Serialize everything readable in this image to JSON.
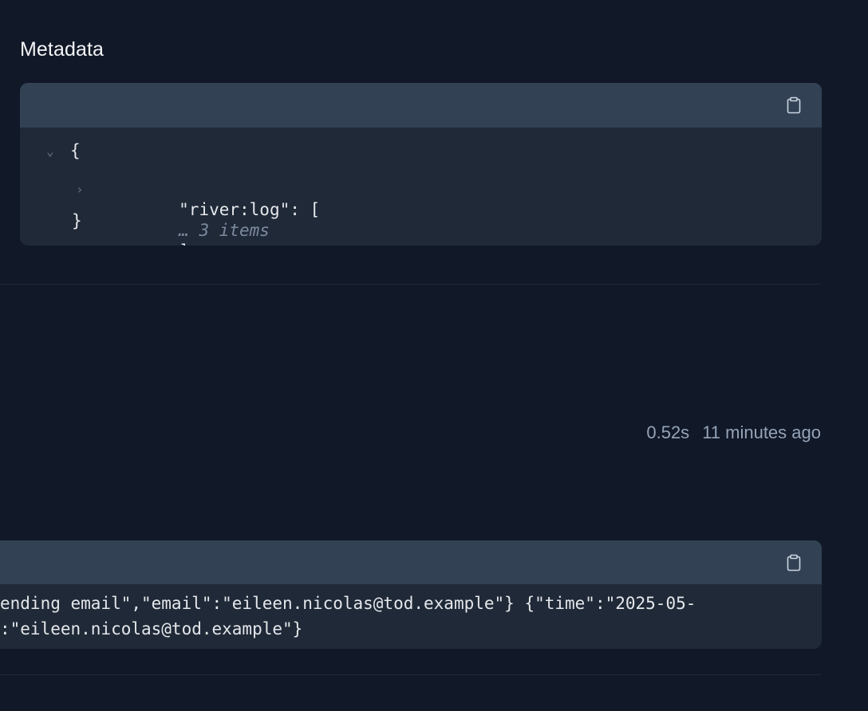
{
  "metadata_section": {
    "title": "Metadata",
    "json": {
      "open_brace": "{",
      "close_brace": "}",
      "entry_key": "\"river:log\": [",
      "entry_hint": "… 3 items",
      "entry_close": "]"
    }
  },
  "run_info": {
    "duration": "0.52s",
    "relative_time": "11 minutes ago"
  },
  "log_section": {
    "line1": "ending email\",\"email\":\"eileen.nicolas@tod.example\"} {\"time\":\"2025-05-",
    "line2": ":\"eileen.nicolas@tod.example\"}"
  },
  "icons": {
    "copy": "clipboard-icon",
    "expanded": "chevron-down-icon",
    "collapsed": "chevron-right-icon"
  }
}
